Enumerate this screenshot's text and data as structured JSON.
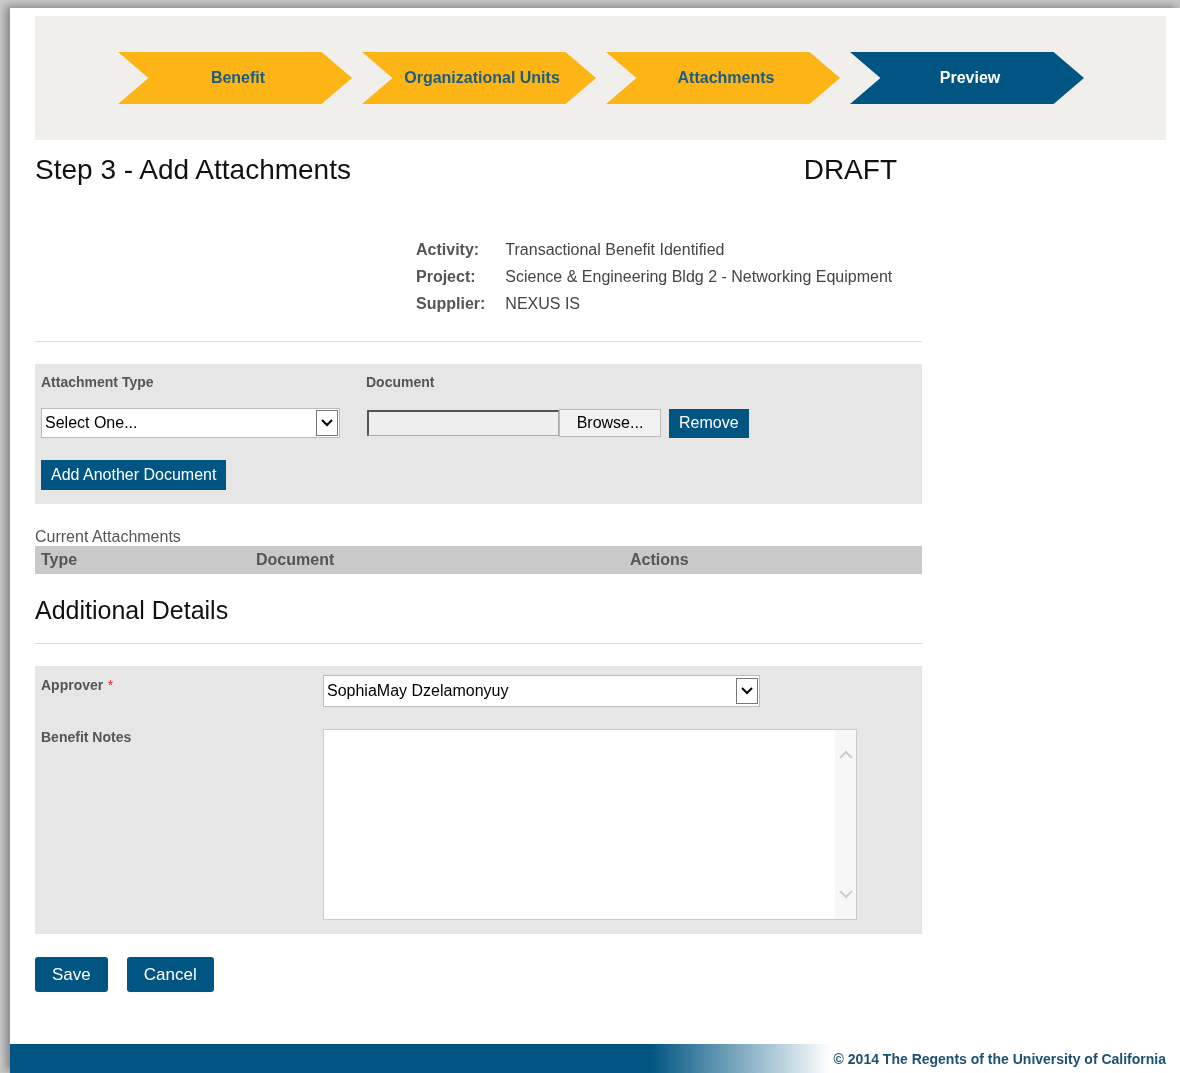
{
  "steps": [
    {
      "label": "Benefit",
      "selected": false
    },
    {
      "label": "Organizational Units",
      "selected": false
    },
    {
      "label": "Attachments",
      "selected": false
    },
    {
      "label": "Preview",
      "selected": true
    }
  ],
  "page_title": "Step 3 - Add Attachments",
  "status": "DRAFT",
  "details": [
    {
      "label": "Activity:",
      "value": "Transactional Benefit Identified"
    },
    {
      "label": "Project:",
      "value": "Science & Engineering Bldg 2 - Networking Equipment"
    },
    {
      "label": "Supplier:",
      "value": "NEXUS IS"
    }
  ],
  "attachment_form": {
    "type_label": "Attachment Type",
    "document_label": "Document",
    "type_value": "Select One...",
    "browse_button": "Browse...",
    "remove_button": "Remove",
    "add_button": "Add Another Document"
  },
  "current_attachments": {
    "title": "Current Attachments",
    "columns": [
      "Type",
      "Document",
      "Actions"
    ]
  },
  "additional_details": {
    "title": "Additional Details",
    "approver_label": "Approver",
    "required_mark": "*",
    "approver_value": "SophiaMay Dzelamonyuy",
    "notes_label": "Benefit Notes"
  },
  "buttons": [
    "Save",
    "Cancel"
  ],
  "footer": "© 2014 The Regents of the University of California"
}
